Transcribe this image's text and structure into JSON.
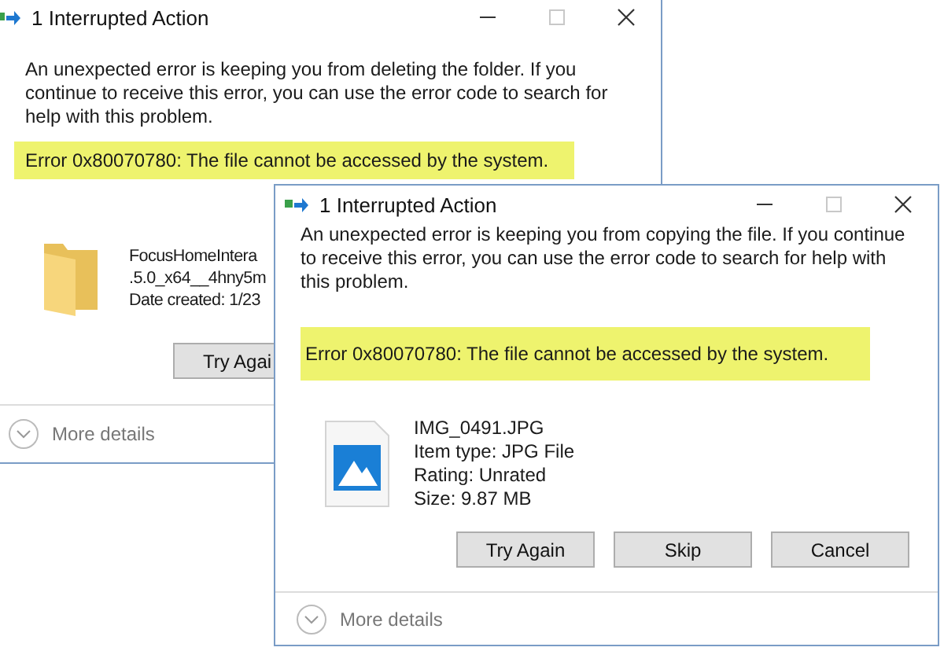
{
  "windows": [
    {
      "title": "1 Interrupted Action",
      "message": "An unexpected error is keeping you from deleting the folder. If you continue to receive this error, you can use the error code to search for help with this problem.",
      "error": "Error 0x80070780: The file cannot be accessed by the system.",
      "file": {
        "kind": "folder",
        "lines": [
          "FocusHomeIntera",
          ".5.0_x64__4hny5m",
          "Date created: 1/23"
        ]
      },
      "buttons": [
        "Try Agai"
      ],
      "more_details": "More details"
    },
    {
      "title": "1 Interrupted Action",
      "message": "An unexpected error is keeping you from copying the file. If you continue to receive this error, you can use the error code to search for help with this problem.",
      "error": "Error 0x80070780: The file cannot be accessed by the system.",
      "file": {
        "kind": "image",
        "lines": [
          "IMG_0491.JPG",
          "Item type: JPG File",
          "Rating: Unrated",
          "Size: 9.87 MB"
        ]
      },
      "buttons": [
        "Try Again",
        "Skip",
        "Cancel"
      ],
      "more_details": "More details"
    }
  ]
}
